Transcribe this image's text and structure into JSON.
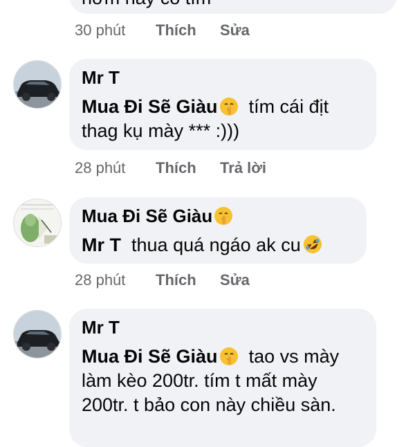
{
  "comments": [
    {
      "text_partial": "hơm nay có tím",
      "time": "30 phút",
      "like_label": "Thích",
      "action_label": "Sửa"
    },
    {
      "author": "Mr T",
      "mention": "Mua Đi Sẽ Giàu",
      "mention_emoji": "shushing-face-emoji",
      "body": "tím cái địt thag kụ mày *** :)))",
      "time": "28 phút",
      "like_label": "Thích",
      "action_label": "Trả lời"
    },
    {
      "author": "Mua Đi Sẽ Giàu",
      "author_emoji": "shushing-face-emoji",
      "mention": "Mr T",
      "body": "thua quá ngáo ak cu",
      "body_emoji": "rolling-on-floor-laughing-emoji",
      "time": "28 phút",
      "like_label": "Thích",
      "action_label": "Sửa"
    },
    {
      "author": "Mr T",
      "mention": "Mua Đi Sẽ Giàu",
      "mention_emoji": "shushing-face-emoji",
      "body": "tao vs mày làm kèo 200tr. tím t mất mày 200tr. t bảo con này chiều sàn."
    }
  ],
  "colors": {
    "bubble": "#f0f2f5",
    "text": "#050505",
    "meta": "#65676b"
  }
}
